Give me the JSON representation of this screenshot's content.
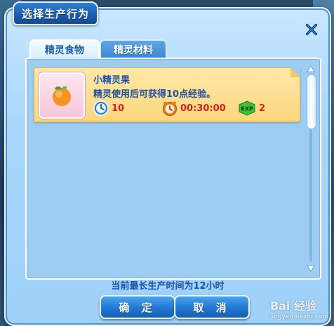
{
  "dialog": {
    "title": "选择生产行为",
    "tabs": [
      {
        "label": "精灵食物",
        "active": true
      },
      {
        "label": "精灵材料",
        "active": false
      }
    ],
    "item": {
      "name": "小精灵果",
      "description": "精灵使用后可获得10点经验。",
      "cost": "10",
      "duration": "00:30:00",
      "exp": "2",
      "exp_badge": "EXP"
    },
    "limit_text": "当前最长生产时间为12小时",
    "confirm_label": "确 定",
    "cancel_label": "取 消"
  },
  "watermark": {
    "brand": "Bai 经验",
    "url": "jingyan.baidu.com"
  },
  "colors": {
    "panel": "#a9d7fb",
    "card": "#fbd77f",
    "text_blue": "#1d50a7",
    "text_red": "#d81f1f",
    "button": "#2178d3"
  },
  "icons": [
    "close-icon",
    "orange-fruit-icon",
    "clock-icon",
    "alarm-clock-icon",
    "exp-badge-icon",
    "scroll-up-arrow-icon",
    "scroll-down-arrow-icon"
  ]
}
